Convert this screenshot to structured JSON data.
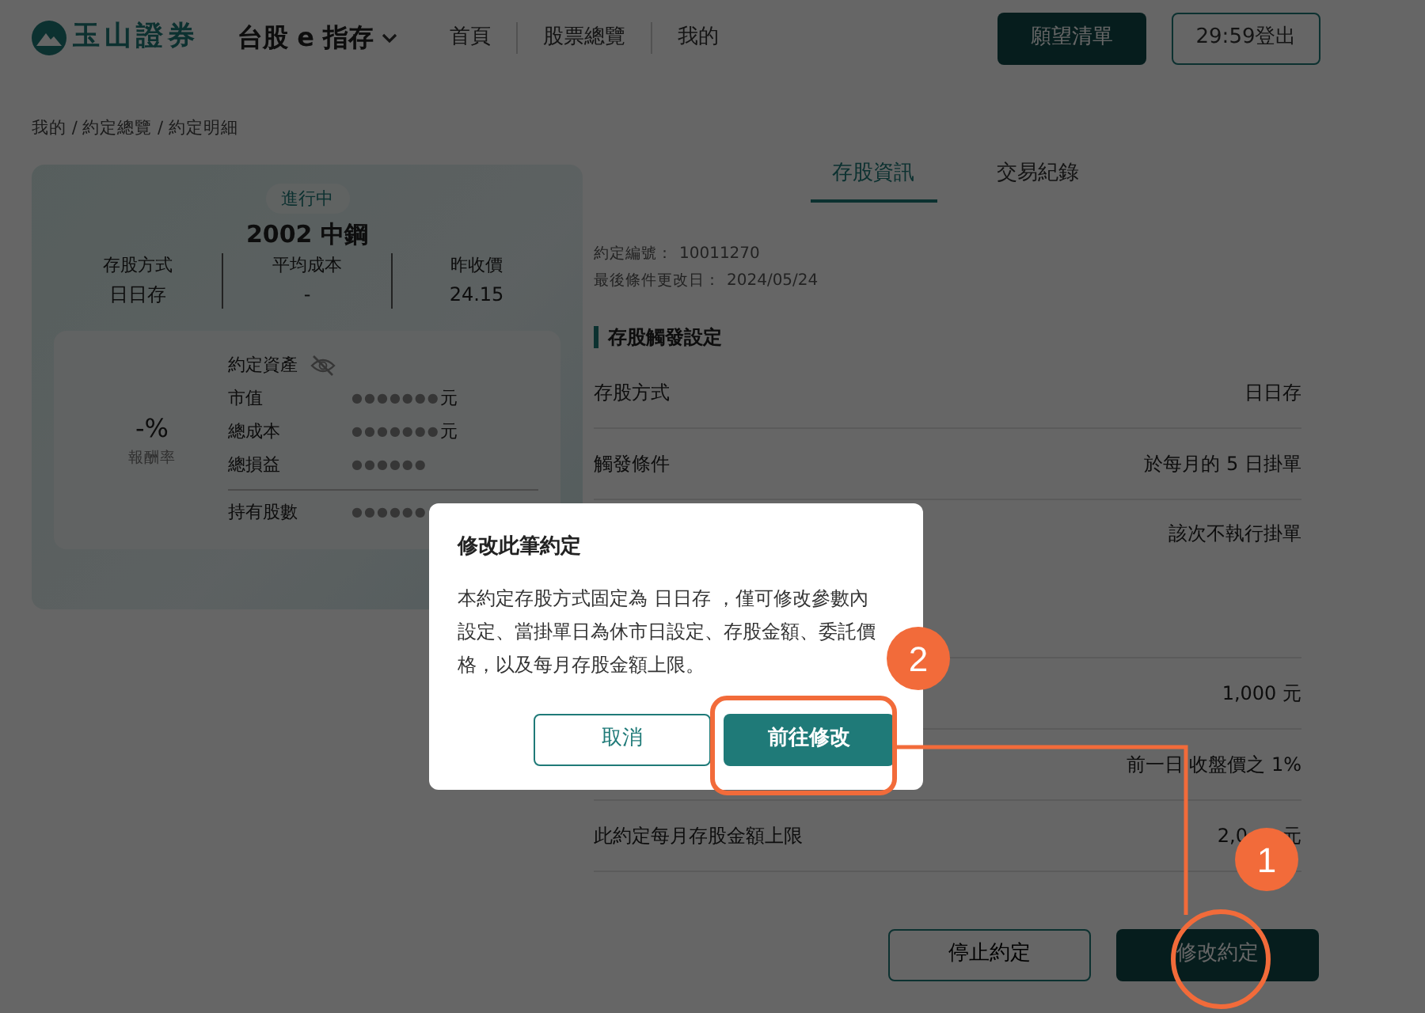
{
  "header": {
    "brand": "玉山證券",
    "product": "台股 e 指存",
    "nav": [
      {
        "label": "首頁"
      },
      {
        "label": "股票總覽"
      },
      {
        "label": "我的"
      }
    ],
    "wishlist_button": "願望清單",
    "logout_button": "29:59登出"
  },
  "breadcrumb": "我的 / 約定總覽 / 約定明細",
  "summary_card": {
    "status": "進行中",
    "stock": "2002 中鋼",
    "stats": [
      {
        "label": "存股方式",
        "value": "日日存"
      },
      {
        "label": "平均成本",
        "value": "-"
      },
      {
        "label": "昨收價",
        "value": "24.15"
      }
    ],
    "return_value": "-%",
    "return_label": "報酬率",
    "assets_title": "約定資產",
    "assets": [
      {
        "label": "市值",
        "masked": "●●●●●●●",
        "unit": "元"
      },
      {
        "label": "總成本",
        "masked": "●●●●●●●",
        "unit": "元"
      },
      {
        "label": "總損益",
        "masked": "●●●●●●"
      },
      {
        "label": "持有股數",
        "masked": "●●●●●●"
      }
    ]
  },
  "tabs": [
    {
      "label": "存股資訊",
      "selected": true
    },
    {
      "label": "交易紀錄",
      "selected": false
    }
  ],
  "meta": [
    {
      "label": "約定編號：",
      "value": "10011270"
    },
    {
      "label": "最後條件更改日：",
      "value": "2024/05/24"
    }
  ],
  "section_title": "存股觸發設定",
  "settings": [
    {
      "label": "存股方式",
      "value": "日日存"
    },
    {
      "label": "觸發條件",
      "value": "於每月的 5 日掛單"
    },
    {
      "value": "該次不執行掛單"
    },
    {
      "value": "1,000 元"
    },
    {
      "value": "前一日 收盤價之 1%"
    },
    {
      "label": "此約定每月存股金額上限",
      "value": "2,0",
      "value_tail": "元"
    }
  ],
  "actions": {
    "stop": "停止約定",
    "modify": "修改約定"
  },
  "modal": {
    "title": "修改此筆約定",
    "body": "本約定存股方式固定為 日日存 ，僅可修改參數內設定、當掛單日為休市日設定、存股金額、委託價格，以及每月存股金額上限。",
    "cancel": "取消",
    "confirm": "前往修改"
  },
  "annotations": [
    {
      "number": "1"
    },
    {
      "number": "2"
    }
  ]
}
